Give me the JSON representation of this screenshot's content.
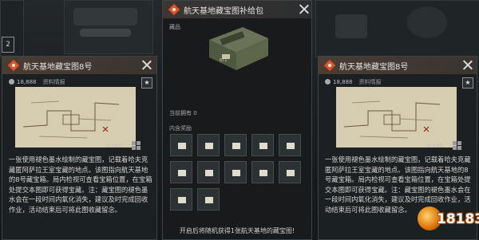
{
  "slot_number": "2",
  "left_card": {
    "title": "航天基地藏宝图8号",
    "value": "18,888",
    "tag": "资料情报",
    "star": "★",
    "weight": "0.1KG",
    "description": "一张使用褪色墨水绘制的藏宝图，记载着哈夫克藏匿阿萨拉王室宝藏的地点。该图指向航天基地的8号藏宝箱。局内检视可查看宝箱位置，在宝箱处提交本图即可获得宝藏。注：藏宝图的褪色墨水会在一段时间内氧化消失，建议及时完成回收作业，活动结束后可将此图收藏留念。"
  },
  "right_card": {
    "title": "航天基地藏宝图8号",
    "value": "18,888",
    "tag": "资料情报",
    "star": "★",
    "weight": "0.1KG",
    "description": "一张使用褪色墨水绘制的藏宝图，记载着哈夫克藏匿阿萨拉王室宝藏的地点。该图指向航天基地的8号藏宝箱。局内检视可查看宝箱位置，在宝箱处提交本图即可获得宝藏。注：藏宝图的褪色墨水会在一段时间内氧化消失，建议及时完成回收作业，活动结束后可将此图收藏留念。"
  },
  "center_panel": {
    "title": "航天基地藏宝图补给包",
    "item_label": "藏品",
    "crate_badge": "6Т1",
    "owned": "当前拥有 0",
    "contents_label": "内含奖励",
    "footer": "开启后将随机获得1张航天基地的藏宝图!"
  },
  "watermark": "18183",
  "colors": {
    "header_accent": "#e0542a",
    "panel_bg": "#181b1d"
  }
}
